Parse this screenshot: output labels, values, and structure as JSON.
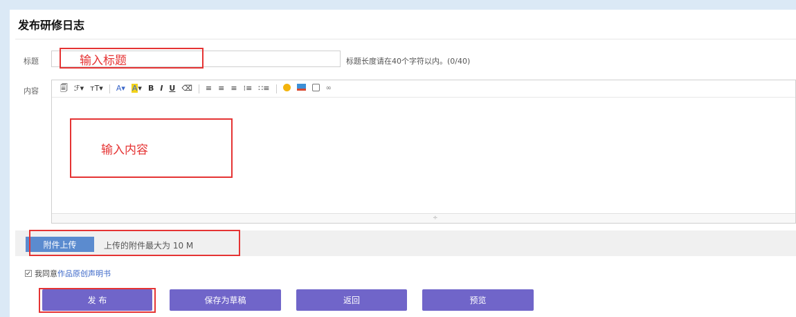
{
  "page": {
    "title": "发布研修日志"
  },
  "title_field": {
    "label": "标题",
    "value": "",
    "hint": "标题长度请在40个字符以内。(0/40)",
    "annotation": "输入标题"
  },
  "content_field": {
    "label": "内容",
    "annotation": "输入内容",
    "toolbar": {
      "source": "🗐",
      "font_family": "ℱ▾",
      "font_size": "тT▾",
      "font_color": "A▾",
      "highlight": "A",
      "highlight_arrow": "▾",
      "bold": "B",
      "italic": "I",
      "underline": "U",
      "eraser": "⌫",
      "align_left": "≡",
      "align_center": "≡",
      "align_right": "≡",
      "ordered_list": "⁝≡",
      "unordered_list": "∷≡",
      "link": "∞"
    },
    "resize_handle": "÷"
  },
  "attachment": {
    "button_label": "附件上传",
    "hint": "上传的附件最大为 10 M"
  },
  "agreement": {
    "text": "我同意",
    "link_text": "作品原创声明书",
    "checked": true
  },
  "actions": {
    "publish": "发 布",
    "save_draft": "保存为草稿",
    "back": "返回",
    "preview": "预览"
  },
  "colors": {
    "button": "#7065c9",
    "annotation": "#e53333",
    "upload_button": "#5b8bcf",
    "link": "#3a66c8"
  }
}
